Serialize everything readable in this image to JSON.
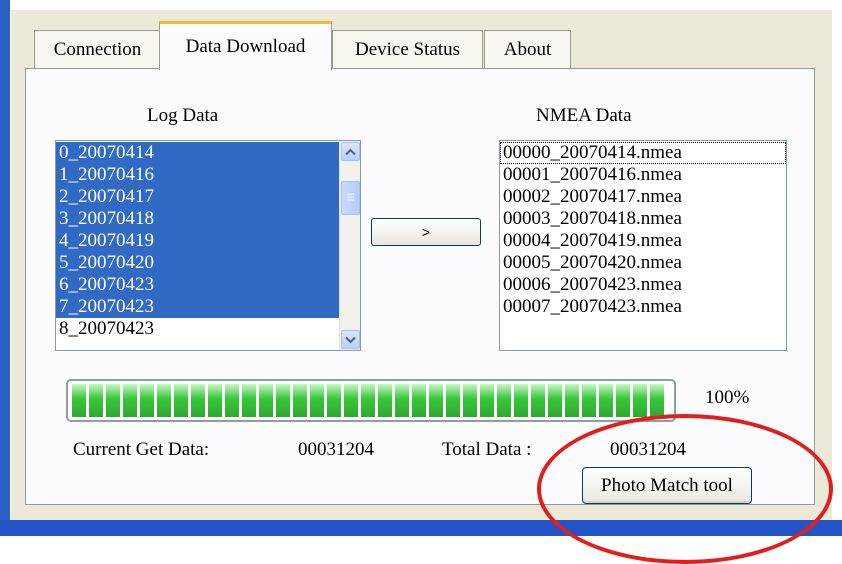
{
  "tabs": [
    {
      "label": "Connection",
      "active": false
    },
    {
      "label": "Data Download",
      "active": true
    },
    {
      "label": "Device Status",
      "active": false
    },
    {
      "label": "About",
      "active": false
    }
  ],
  "log_data": {
    "title": "Log Data",
    "items": [
      "0_20070414",
      "1_20070416",
      "2_20070417",
      "3_20070418",
      "4_20070419",
      "5_20070420",
      "6_20070423",
      "7_20070423",
      "8_20070423"
    ],
    "selected_count": 8
  },
  "transfer_button_label": ">",
  "nmea_data": {
    "title": "NMEA Data",
    "items": [
      "00000_20070414.nmea",
      "00001_20070416.nmea",
      "00002_20070417.nmea",
      "00003_20070418.nmea",
      "00004_20070419.nmea",
      "00005_20070420.nmea",
      "00006_20070423.nmea",
      "00007_20070423.nmea"
    ]
  },
  "progress": {
    "value": 1.0,
    "text": "100%"
  },
  "status": {
    "current_label": "Current Get Data:",
    "current_value": "00031204",
    "total_label": "Total Data :",
    "total_value": "00031204"
  },
  "photo_match_label": "Photo Match tool",
  "colors": {
    "selection": "#316ac5",
    "annotation": "#e31c1c",
    "progress": "#36c63a",
    "tab_highlight": "#f4b73c"
  }
}
